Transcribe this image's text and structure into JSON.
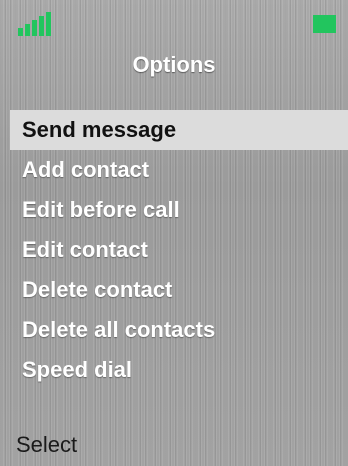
{
  "status": {
    "signal_icon": "signal-strength-icon",
    "battery_icon": "battery-icon",
    "accent_color": "#22c55e"
  },
  "title": "Options",
  "menu": {
    "selected_index": 0,
    "items": [
      {
        "label": "Send message"
      },
      {
        "label": "Add contact"
      },
      {
        "label": "Edit before call"
      },
      {
        "label": "Edit contact"
      },
      {
        "label": "Delete contact"
      },
      {
        "label": "Delete all contacts"
      },
      {
        "label": "Speed dial"
      }
    ]
  },
  "softkeys": {
    "left": "Select"
  }
}
